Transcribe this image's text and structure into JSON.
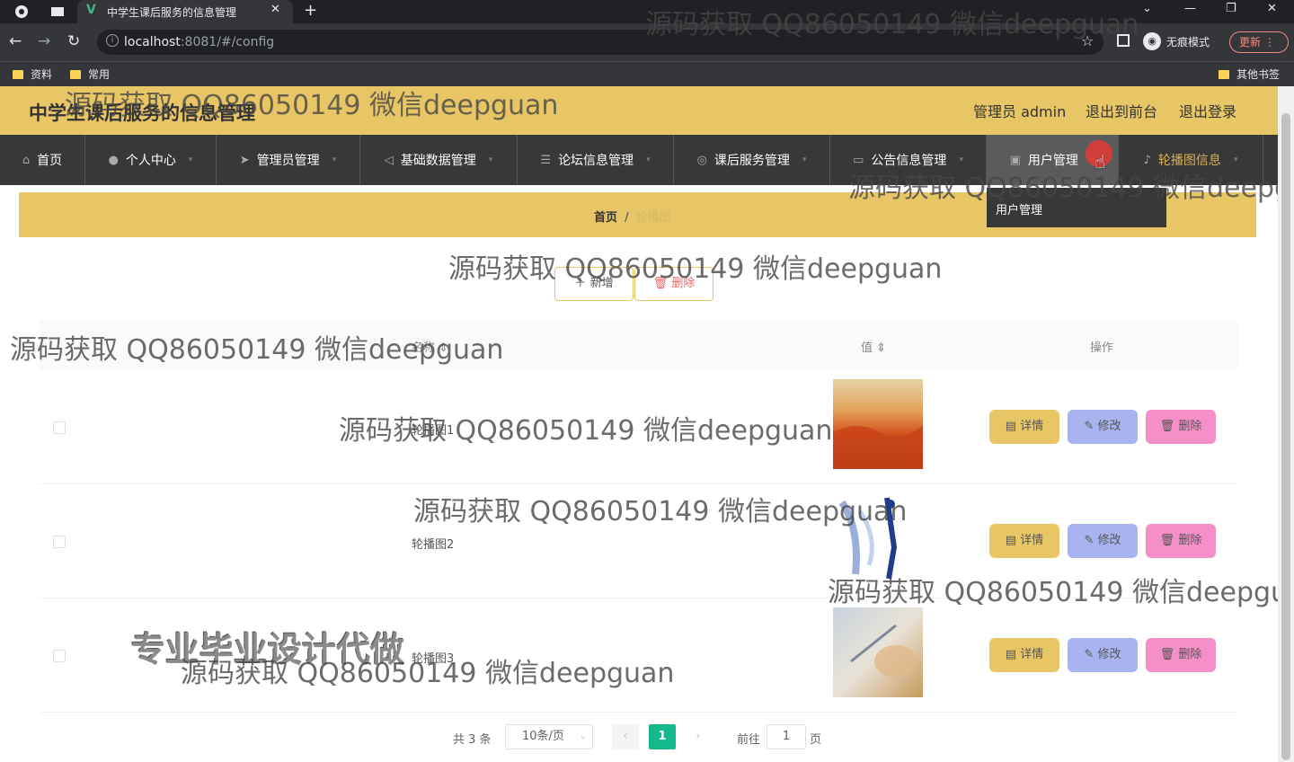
{
  "browser": {
    "tab_title": "中学生课后服务的信息管理",
    "url_host": "localhost",
    "url_rest": ":8081/#/config",
    "incognito_label": "无痕模式",
    "update_label": "更新",
    "bookmarks": [
      "资料",
      "常用"
    ],
    "other_bookmarks": "其他书签"
  },
  "header": {
    "title": "中学生课后服务的信息管理",
    "admin_label": "管理员 admin",
    "to_front": "退出到前台",
    "logout": "退出登录"
  },
  "nav": {
    "items": [
      "首页",
      "个人中心",
      "管理员管理",
      "基础数据管理",
      "论坛信息管理",
      "课后服务管理",
      "公告信息管理",
      "用户管理",
      "轮播图信息"
    ],
    "dropdown_item": "用户管理"
  },
  "breadcrumb": {
    "home": "首页",
    "sep": "/",
    "current": "轮播图"
  },
  "toolbar": {
    "add": "新增",
    "delete": "删除"
  },
  "table": {
    "headers": [
      "名称",
      "值",
      "操作"
    ],
    "rows": [
      {
        "name": "轮播图1"
      },
      {
        "name": "轮播图2"
      },
      {
        "name": "轮播图3"
      }
    ],
    "actions": {
      "detail": "详情",
      "edit": "修改",
      "remove": "删除"
    }
  },
  "pagination": {
    "total": "共 3 条",
    "page_size": "10条/页",
    "current_page": "1",
    "goto_label": "前往",
    "goto_value": "1",
    "page_suffix": "页"
  },
  "watermarks": {
    "text": "源码获取 QQ86050149 微信deepguan",
    "big": "专业毕业设计代做"
  },
  "colors": {
    "accent": "#e8c565",
    "nav_bg": "#383838",
    "page_active": "#13b98b"
  }
}
